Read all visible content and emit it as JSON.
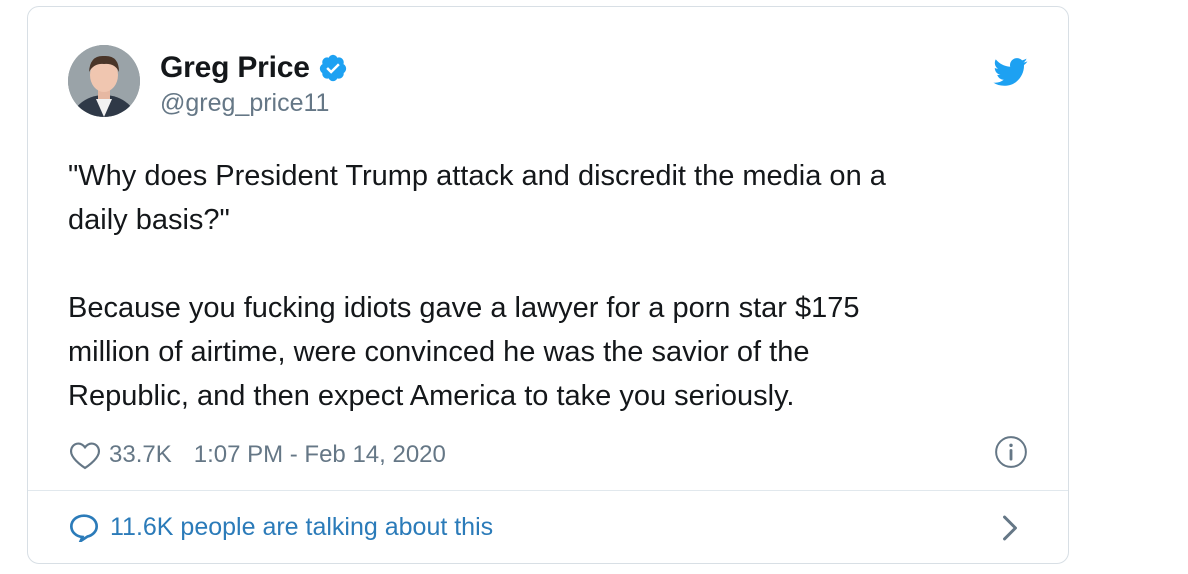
{
  "author": {
    "display_name": "Greg Price",
    "handle": "@greg_price11",
    "verified": true
  },
  "tweet": {
    "text": "\"Why does President Trump attack and discredit the media on a\ndaily basis?\"\n\nBecause you fucking idiots gave a lawyer for a porn star $175\nmillion of airtime, were convinced he was the savior of the\nRepublic, and then expect America to take you seriously.",
    "likes": "33.7K",
    "timestamp": "1:07 PM - Feb 14, 2020"
  },
  "footer": {
    "talking_text": "11.6K people are talking about this"
  },
  "icons": {
    "brand": "twitter-bird-icon",
    "verified": "verified-badge-icon",
    "like": "heart-icon",
    "info": "info-icon",
    "conversation": "speech-bubble-icon",
    "next": "chevron-right-icon"
  },
  "colors": {
    "twitter_blue": "#1da1f2",
    "link_blue": "#2b7bb9",
    "secondary_text": "#657786",
    "border": "#d8dfe5"
  }
}
